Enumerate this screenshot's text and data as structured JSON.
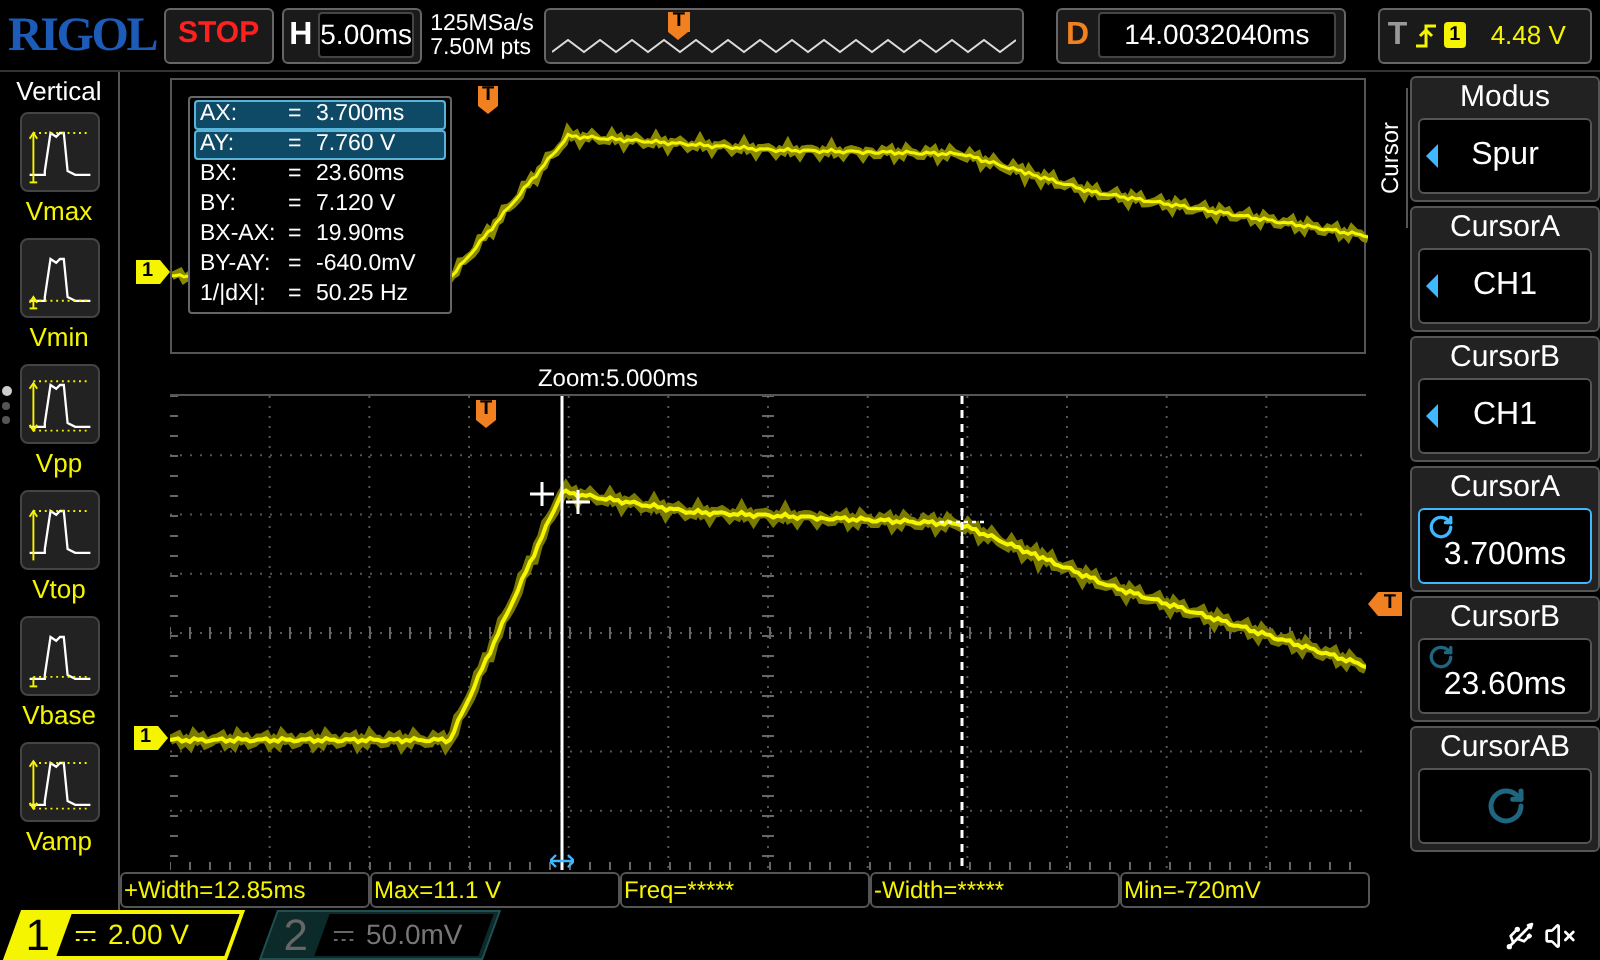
{
  "logo": "RIGOL",
  "run_state": "STOP",
  "horizontal": {
    "label": "H",
    "timebase": "5.00ms"
  },
  "acquisition": {
    "sample_rate": "125MSa/s",
    "memory_depth": "7.50M pts"
  },
  "memory_bar": {
    "trigger_marker": "T"
  },
  "delay": {
    "label": "D",
    "value": "14.0032040ms"
  },
  "trigger": {
    "label": "T",
    "channel": "1",
    "level": "4.48 V"
  },
  "sidebar": {
    "title": "Vertical",
    "pages": [
      {
        "selected": true
      },
      {
        "selected": false
      },
      {
        "selected": false
      }
    ],
    "items": [
      {
        "kind": "max",
        "label": "Vmax"
      },
      {
        "kind": "min",
        "label": "Vmin"
      },
      {
        "kind": "pp",
        "label": "Vpp"
      },
      {
        "kind": "top",
        "label": "Vtop"
      },
      {
        "kind": "base",
        "label": "Vbase"
      },
      {
        "kind": "amp",
        "label": "Vamp"
      }
    ]
  },
  "main_window": {
    "channel_marker": "1",
    "trigger_marker": "T",
    "cursor_readout": [
      {
        "label": "AX:",
        "equals": "=",
        "value": "3.700ms",
        "selected": true
      },
      {
        "label": "AY:",
        "equals": "=",
        "value": "7.760 V",
        "selected": true
      },
      {
        "label": "BX:",
        "equals": "=",
        "value": "23.60ms",
        "selected": false
      },
      {
        "label": "BY:",
        "equals": "=",
        "value": "7.120 V",
        "selected": false
      },
      {
        "label": "BX-AX:",
        "equals": "=",
        "value": "19.90ms",
        "selected": false
      },
      {
        "label": "BY-AY:",
        "equals": "=",
        "value": "-640.0mV",
        "selected": false
      },
      {
        "label": "1/|dX|:",
        "equals": "=",
        "value": "50.25 Hz",
        "selected": false
      }
    ]
  },
  "zoom_window": {
    "title": "Zoom:5.000ms",
    "channel_marker": "1",
    "trigger_marker": "T",
    "trigger_level_marker": "T"
  },
  "measurements": [
    "+Width=12.85ms",
    "Max=11.1 V",
    "Freq=*****",
    "-Width=*****",
    "Min=-720mV"
  ],
  "menu": {
    "tab": "Cursor",
    "items": [
      {
        "kind": "select",
        "title": "Modus",
        "value": "Spur",
        "selected": false
      },
      {
        "kind": "select",
        "title": "CursorA",
        "value": "CH1",
        "selected": false
      },
      {
        "kind": "select",
        "title": "CursorB",
        "value": "CH1",
        "selected": false
      },
      {
        "kind": "knob",
        "title": "CursorA",
        "value": "3.700ms",
        "selected": true
      },
      {
        "kind": "knob",
        "title": "CursorB",
        "value": "23.60ms",
        "selected": false
      },
      {
        "kind": "knob",
        "title": "CursorAB",
        "selected": false
      }
    ]
  },
  "channels": [
    {
      "number": "1",
      "scale": "2.00 V",
      "on": true
    },
    {
      "number": "2",
      "scale": "50.0mV",
      "on": false
    }
  ]
}
